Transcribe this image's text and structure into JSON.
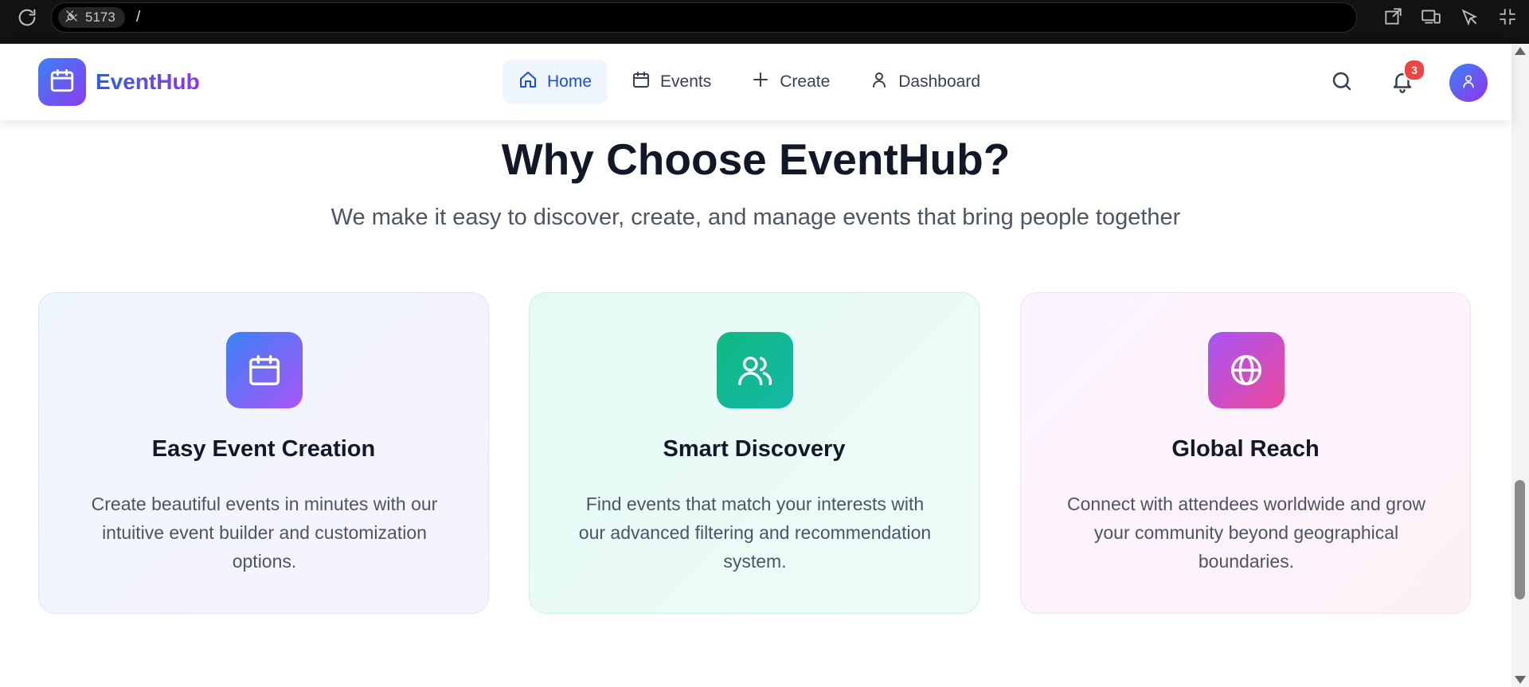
{
  "browser": {
    "port": "5173",
    "path": "/"
  },
  "header": {
    "brand": "EventHub",
    "nav": [
      {
        "label": "Home",
        "icon": "home-icon",
        "active": true
      },
      {
        "label": "Events",
        "icon": "calendar-icon",
        "active": false
      },
      {
        "label": "Create",
        "icon": "plus-icon",
        "active": false
      },
      {
        "label": "Dashboard",
        "icon": "user-icon",
        "active": false
      }
    ],
    "notification_count": "3"
  },
  "section": {
    "title": "Why Choose EventHub?",
    "subtitle": "We make it easy to discover, create, and manage events that bring people together",
    "features": [
      {
        "title": "Easy Event Creation",
        "description": "Create beautiful events in minutes with our intuitive event builder and customization options.",
        "icon": "calendar-icon",
        "accent": "#3b82f6"
      },
      {
        "title": "Smart Discovery",
        "description": "Find events that match your interests with our advanced filtering and recommendation system.",
        "icon": "users-icon",
        "accent": "#10b981"
      },
      {
        "title": "Global Reach",
        "description": "Connect with attendees worldwide and grow your community beyond geographical boundaries.",
        "icon": "globe-icon",
        "accent": "#a855f7"
      }
    ]
  },
  "colors": {
    "primary": "#2563eb",
    "secondary": "#9333ea",
    "badge": "#ef4444"
  }
}
